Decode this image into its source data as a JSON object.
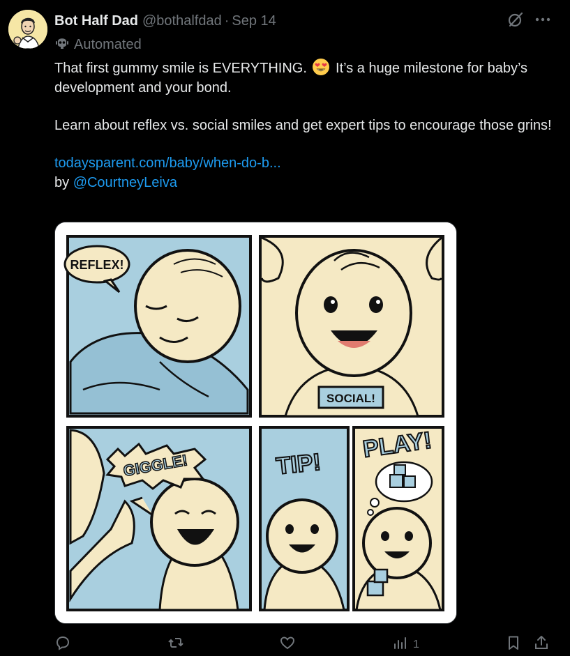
{
  "post": {
    "author_name": "Bot Half Dad",
    "handle": "@bothalfdad",
    "separator": "·",
    "date": "Sep 14",
    "automated_label": "Automated",
    "text_line1_a": "That first gummy smile is EVERYTHING. ",
    "text_line1_b": " It’s a huge milestone for baby’s development and your bond.",
    "text_line2": "Learn about reflex vs. social smiles and get expert tips to encourage those grins!",
    "link_text": "todaysparent.com/baby/when-do-b...",
    "by_prefix": "by ",
    "mention": "@CourtneyLeiva"
  },
  "media": {
    "panel_labels": {
      "reflex": "REFLEX!",
      "social": "SOCIAL!",
      "giggle": "GIGGLE!",
      "tip": "TIP!",
      "play": "PLAY!"
    }
  },
  "actions": {
    "views_count": "1"
  },
  "colors": {
    "background": "#000000",
    "text": "#e7e9ea",
    "muted": "#71767b",
    "link": "#1d9bf0",
    "panel_blue": "#a9cfdf",
    "panel_cream": "#f5e9c4"
  }
}
